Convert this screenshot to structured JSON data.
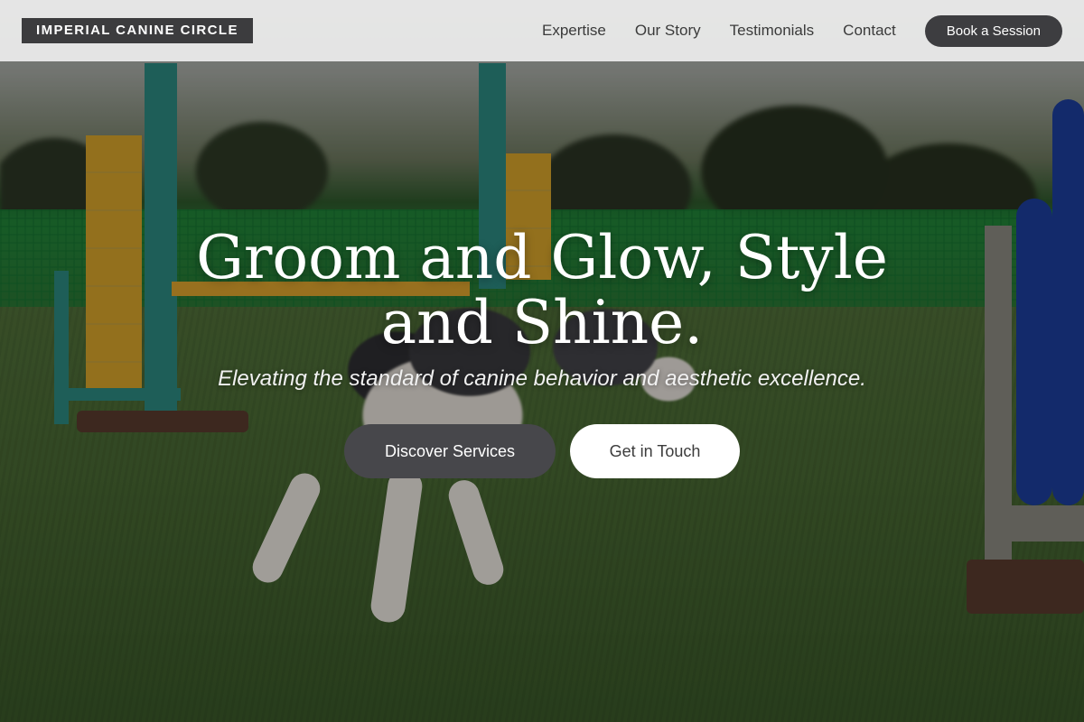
{
  "header": {
    "logo": "IMPERIAL CANINE CIRCLE",
    "nav": [
      "Expertise",
      "Our Story",
      "Testimonials",
      "Contact"
    ],
    "cta": "Book a Session"
  },
  "hero": {
    "headline": "Groom and Glow, Style and Shine.",
    "subhead": "Elevating the standard of canine behavior and aesthetic excellence.",
    "primary_button": "Discover Services",
    "secondary_button": "Get in Touch"
  }
}
